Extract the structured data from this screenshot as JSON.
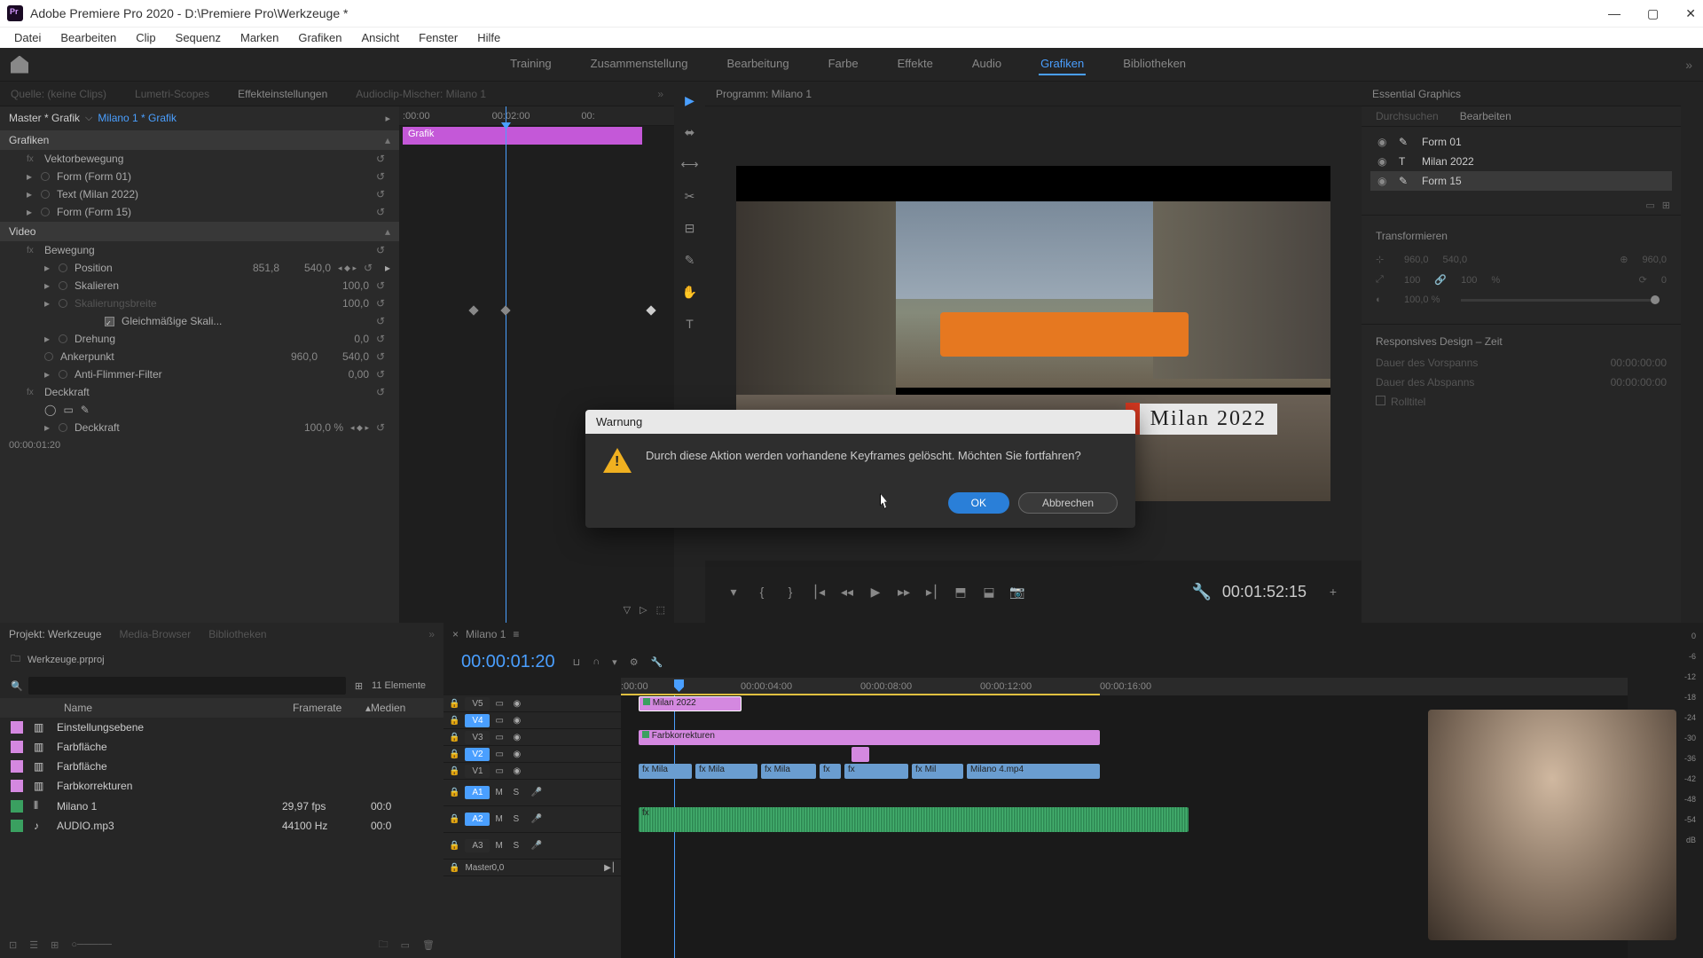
{
  "titlebar": {
    "app": "Adobe Premiere Pro 2020",
    "project": "D:\\Premiere Pro\\Werkzeuge *"
  },
  "menu": [
    "Datei",
    "Bearbeiten",
    "Clip",
    "Sequenz",
    "Marken",
    "Grafiken",
    "Ansicht",
    "Fenster",
    "Hilfe"
  ],
  "workspaces": [
    "Training",
    "Zusammenstellung",
    "Bearbeitung",
    "Farbe",
    "Effekte",
    "Audio",
    "Grafiken",
    "Bibliotheken"
  ],
  "workspace_active": "Grafiken",
  "source_tabs": [
    "Quelle: (keine Clips)",
    "Lumetri-Scopes",
    "Effekteinstellungen",
    "Audioclip-Mischer: Milano 1"
  ],
  "effect_controls": {
    "master": "Master * Grafik",
    "clip": "Milano 1 * Grafik",
    "mini_ruler": {
      "t0": ":00:00",
      "t1": "00:02:00",
      "t2": "00:"
    },
    "mini_clip": "Grafik",
    "tc": "00:00:01:20",
    "sections": {
      "grafiken": "Grafiken",
      "video": "Video"
    },
    "rows": {
      "vektorbewegung": "Vektorbewegung",
      "form01": "Form (Form 01)",
      "text_milan": "Text (Milan 2022)",
      "form15": "Form (Form 15)",
      "bewegung": "Bewegung",
      "position": "Position",
      "position_v1": "851,8",
      "position_v2": "540,0",
      "skalieren": "Skalieren",
      "skalieren_v": "100,0",
      "skalierungsbreite": "Skalierungsbreite",
      "skalierungsbreite_v": "100,0",
      "gleichmassig": "Gleichmäßige Skali...",
      "drehung": "Drehung",
      "drehung_v": "0,0",
      "ankerpunkt": "Ankerpunkt",
      "ankerpunkt_v1": "960,0",
      "ankerpunkt_v2": "540,0",
      "antiflimmer": "Anti-Flimmer-Filter",
      "antiflimmer_v": "0,00",
      "deckkraft": "Deckkraft",
      "deckkraft2": "Deckkraft",
      "deckkraft_v": "100,0 %"
    }
  },
  "program": {
    "tab": "Programm: Milano 1",
    "title": "Milan 2022",
    "tc": "00:01:52:15"
  },
  "essential_graphics": {
    "panel": "Essential Graphics",
    "tabs": [
      "Durchsuchen",
      "Bearbeiten"
    ],
    "layers": [
      {
        "name": "Form 01",
        "type": "shape"
      },
      {
        "name": "Milan 2022",
        "type": "text"
      },
      {
        "name": "Form 15",
        "type": "shape"
      }
    ],
    "transform": "Transformieren",
    "tx_pos": [
      "960,0",
      "540,0"
    ],
    "tx_anchor": "960,0",
    "tx_scale": [
      "100",
      "100",
      "%"
    ],
    "tx_rot": "0",
    "tx_opacity": "100,0 %",
    "responsive": "Responsives Design – Zeit",
    "vorspann": "Dauer des Vorspanns",
    "vorspann_v": "00:00:00:00",
    "abspann": "Dauer des Abspanns",
    "abspann_v": "00:00:00:00",
    "rolltitel": "Rolltitel"
  },
  "project": {
    "tabs": [
      "Projekt: Werkzeuge",
      "Media-Browser",
      "Bibliotheken"
    ],
    "name": "Werkzeuge.prproj",
    "count": "11 Elemente",
    "columns": {
      "name": "Name",
      "framerate": "Framerate",
      "media": "Medien"
    },
    "items": [
      {
        "name": "Einstellungsebene",
        "fr": "",
        "med": "",
        "color": "#d488e0"
      },
      {
        "name": "Farbfläche",
        "fr": "",
        "med": "",
        "color": "#d488e0"
      },
      {
        "name": "Farbfläche",
        "fr": "",
        "med": "",
        "color": "#d488e0"
      },
      {
        "name": "Farbkorrekturen",
        "fr": "",
        "med": "",
        "color": "#d488e0"
      },
      {
        "name": "Milano 1",
        "fr": "29,97 fps",
        "med": "00:0",
        "color": "#3aa060"
      },
      {
        "name": "AUDIO.mp3",
        "fr": "44100 Hz",
        "med": "00:0",
        "color": "#3aa060"
      }
    ]
  },
  "timeline": {
    "tab": "Milano 1",
    "tc": "00:00:01:20",
    "ruler": [
      ":00:00",
      "00:00:04:00",
      "00:00:08:00",
      "00:00:12:00",
      "00:00:16:00"
    ],
    "master": "Master",
    "master_v": "0,0",
    "tracks_v": [
      "V5",
      "V4",
      "V3",
      "V2",
      "V1"
    ],
    "tracks_a": [
      "A1",
      "A2",
      "A3"
    ],
    "clips": {
      "milan2022": "Milan 2022",
      "farbkorrekturen": "Farbkorrekturen",
      "mila1": "Mila",
      "mila2": "Mila",
      "mila3": "Mila",
      "mil": "Mil",
      "milano4": "Milano 4.mp4"
    }
  },
  "meters": [
    "0",
    "-6",
    "-12",
    "-18",
    "-24",
    "-30",
    "-36",
    "-42",
    "-48",
    "-54",
    "dB"
  ],
  "dialog": {
    "title": "Warnung",
    "message": "Durch diese Aktion werden vorhandene Keyframes gelöscht. Möchten Sie fortfahren?",
    "ok": "OK",
    "cancel": "Abbrechen"
  }
}
